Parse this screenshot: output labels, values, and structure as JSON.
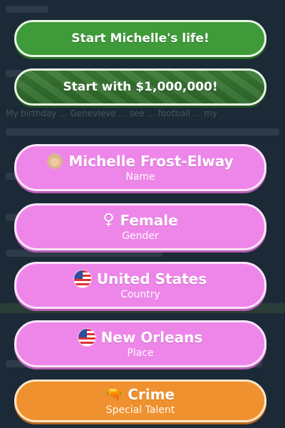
{
  "actions": {
    "start_life_label": "Start Michelle's life!",
    "start_money_label": "Start with $1,000,000!"
  },
  "options": [
    {
      "icon": "person-avatar-icon",
      "value": "Michelle Frost-Elway",
      "caption": "Name"
    },
    {
      "icon": "female-sign-icon",
      "glyph": "♀",
      "value": "Female",
      "caption": "Gender"
    },
    {
      "icon": "us-flag-icon",
      "value": "United States",
      "caption": "Country"
    },
    {
      "icon": "us-flag-icon",
      "value": "New Orleans",
      "caption": "Place"
    }
  ],
  "talent": {
    "icon": "pistol-icon",
    "glyph": "🔫",
    "value": "Crime",
    "caption": "Special Talent"
  },
  "background_snippet": "My birthday ... Genevieve ... see ... football ... my"
}
